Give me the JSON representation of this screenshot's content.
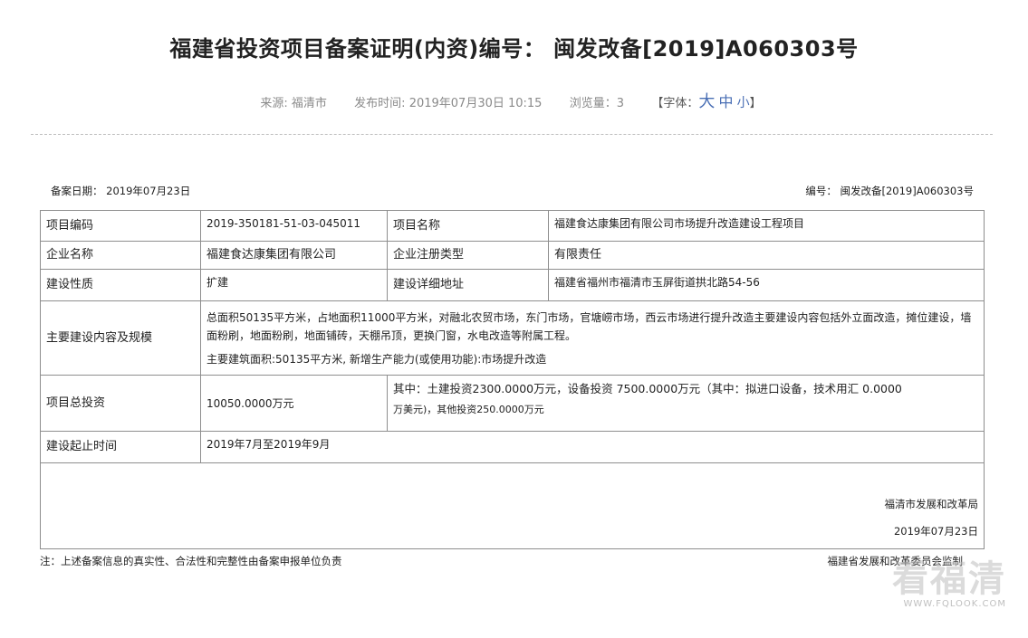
{
  "article": {
    "title": "福建省投资项目备案证明(内资)编号： 闽发改备[2019]A060303号",
    "source_label": "来源: ",
    "source": "福清市",
    "publish_label": "发布时间: ",
    "publish_time": "2019年07月30日 10:15",
    "views_label": "浏览量：",
    "views": "3",
    "font_open": "【字体：",
    "font_large": "大",
    "font_medium": "中",
    "font_small": "小",
    "font_close": "】"
  },
  "record": {
    "date_label": "备案日期：",
    "date": "2019年07月23日",
    "number_label": "编号：",
    "number": "闽发改备[2019]A060303号",
    "rows": {
      "project_code_label": "项目编码",
      "project_code": "2019-350181-51-03-045011",
      "project_name_label": "项目名称",
      "project_name": "福建食达康集团有限公司市场提升改造建设工程项目",
      "company_label": "企业名称",
      "company": "福建食达康集团有限公司",
      "reg_type_label": "企业注册类型",
      "reg_type": "有限责任",
      "nature_label": "建设性质",
      "nature": "扩建",
      "address_label": "建设详细地址",
      "address": "福建省福州市福清市玉屏街道拱北路54-56",
      "scope_label": "主要建设内容及规模",
      "scope_text": "总面积50135平方米，占地面积11000平方米，对融北农贸市场，东门市场，官塘崂市场，西云市场进行提升改造主要建设内容包括外立面改造，摊位建设，墙面粉刷，地面粉刷，地面铺砖，天棚吊顶，更换门窗，水电改造等附属工程。",
      "scope_area": "主要建筑面积:50135平方米, 新增生产能力(或使用功能):市场提升改造",
      "investment_label": "项目总投资",
      "investment": "10050.0000万元",
      "investment_detail_1": "其中：土建投资2300.0000万元，设备投资 7500.0000万元（其中：拟进口设备，技术用汇 0.0000",
      "investment_detail_2": "万美元)，其他投资250.0000万元",
      "period_label": "建设起止时间",
      "period": "2019年7月至2019年9月"
    },
    "authority": "福清市发展和改革局",
    "sign_date": "2019年07月23日",
    "note": "注：上述备案信息的真实性、合法性和完整性由备案申报单位负责",
    "supervisor": "福建省发展和改革委员会监制"
  },
  "watermark": {
    "text": "看福清",
    "url": "WWW.FQLOOK.COM"
  }
}
